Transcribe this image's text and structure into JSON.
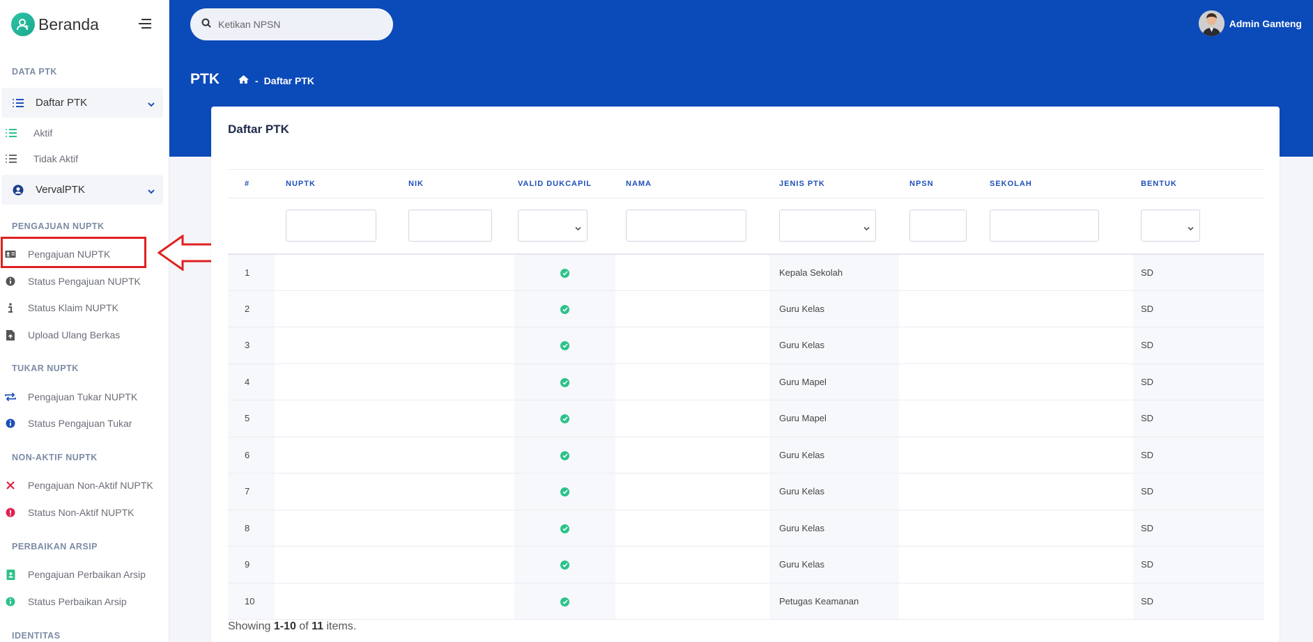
{
  "brand": {
    "title": "Beranda"
  },
  "sidebar": {
    "sections": {
      "data_ptk": "DATA PTK",
      "pengajuan_nuptk": "PENGAJUAN NUPTK",
      "tukar_nuptk": "TUKAR NUPTK",
      "non_aktif_nuptk": "NON-AKTIF NUPTK",
      "perbaikan_arsip": "PERBAIKAN ARSIP",
      "identitas": "IDENTITAS"
    },
    "daftar_ptk": "Daftar PTK",
    "aktif": "Aktif",
    "tidak_aktif": "Tidak Aktif",
    "verval_ptk": "VervalPTK",
    "pengajuan_nuptk": "Pengajuan NUPTK",
    "status_pengajuan_nuptk": "Status Pengajuan NUPTK",
    "status_klaim_nuptk": "Status Klaim NUPTK",
    "upload_ulang_berkas": "Upload Ulang Berkas",
    "pengajuan_tukar_nuptk": "Pengajuan Tukar NUPTK",
    "status_pengajuan_tukar": "Status Pengajuan Tukar",
    "pengajuan_non_aktif_nuptk": "Pengajuan Non-Aktif NUPTK",
    "status_non_aktif_nuptk": "Status Non-Aktif NUPTK",
    "pengajuan_perbaikan_arsip": "Pengajuan Perbaikan Arsip",
    "status_perbaikan_arsip": "Status Perbaikan Arsip"
  },
  "header": {
    "search_placeholder": "Ketikan NPSN",
    "user_name": "Admin Ganteng",
    "page_title": "PTK",
    "breadcrumb_sep": "-",
    "breadcrumb_current": "Daftar PTK"
  },
  "card": {
    "title": "Daftar PTK",
    "columns": [
      "#",
      "NUPTK",
      "NIK",
      "VALID DUKCAPIL",
      "NAMA",
      "JENIS PTK",
      "NPSN",
      "SEKOLAH",
      "BENTUK"
    ],
    "rows": [
      {
        "no": "1",
        "jenis": "Kepala Sekolah",
        "bentuk": "SD"
      },
      {
        "no": "2",
        "jenis": "Guru Kelas",
        "bentuk": "SD"
      },
      {
        "no": "3",
        "jenis": "Guru Kelas",
        "bentuk": "SD"
      },
      {
        "no": "4",
        "jenis": "Guru Mapel",
        "bentuk": "SD"
      },
      {
        "no": "5",
        "jenis": "Guru Mapel",
        "bentuk": "SD"
      },
      {
        "no": "6",
        "jenis": "Guru Kelas",
        "bentuk": "SD"
      },
      {
        "no": "7",
        "jenis": "Guru Kelas",
        "bentuk": "SD"
      },
      {
        "no": "8",
        "jenis": "Guru Kelas",
        "bentuk": "SD"
      },
      {
        "no": "9",
        "jenis": "Guru Kelas",
        "bentuk": "SD"
      },
      {
        "no": "10",
        "jenis": "Petugas Keamanan",
        "bentuk": "SD"
      }
    ],
    "summary": {
      "prefix": "Showing ",
      "range": "1-10",
      "middle": " of ",
      "total": "11",
      "suffix": " items."
    }
  },
  "colors": {
    "primary": "#0b4ab9",
    "accent": "#2cc28a",
    "highlight": "#e02020"
  }
}
